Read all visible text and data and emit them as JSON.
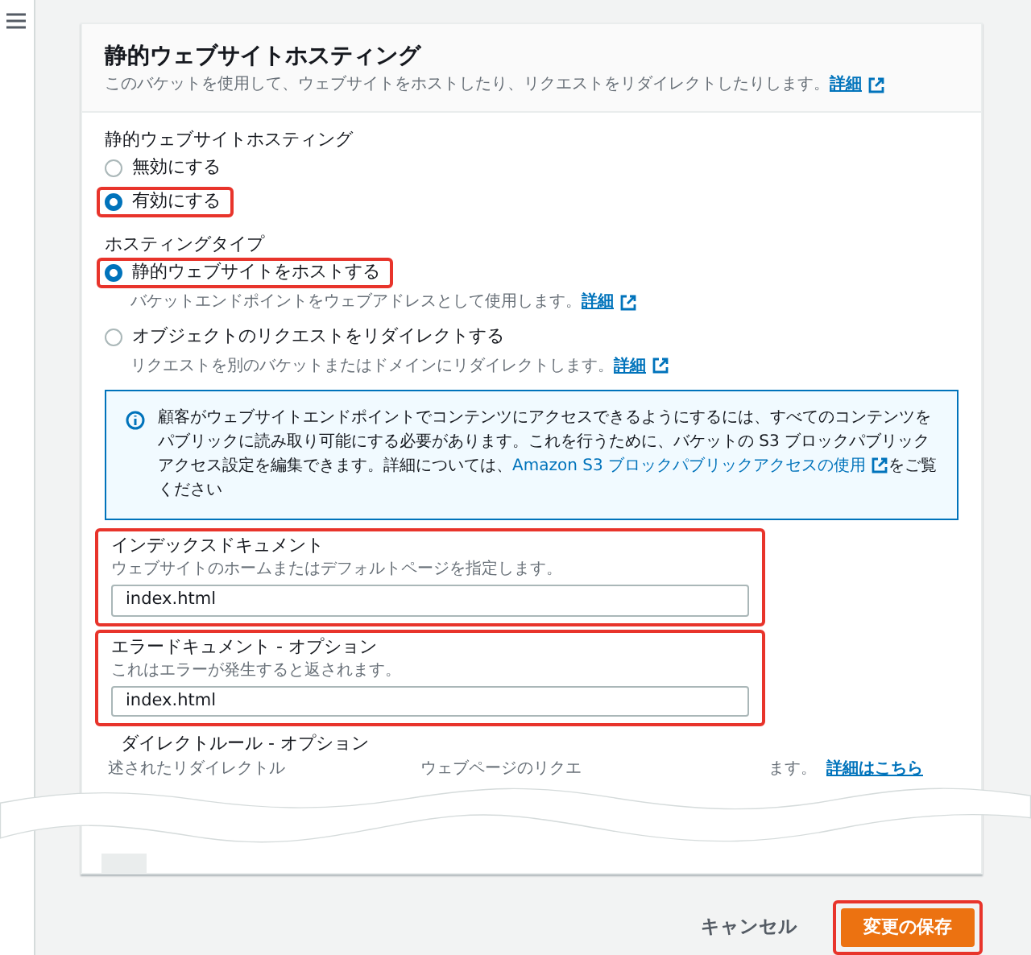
{
  "panel": {
    "title": "静的ウェブサイトホスティング",
    "description": "このバケットを使用して、ウェブサイトをホストしたり、リクエストをリダイレクトしたりします。",
    "description_link": "詳細"
  },
  "hosting": {
    "label": "静的ウェブサイトホスティング",
    "options": [
      {
        "label": "無効にする",
        "selected": false,
        "highlighted": false
      },
      {
        "label": "有効にする",
        "selected": true,
        "highlighted": true
      }
    ]
  },
  "hosting_type": {
    "label": "ホスティングタイプ",
    "options": [
      {
        "label": "静的ウェブサイトをホストする",
        "hint": "バケットエンドポイントをウェブアドレスとして使用します。",
        "hint_link": "詳細",
        "selected": true,
        "highlighted": true
      },
      {
        "label": "オブジェクトのリクエストをリダイレクトする",
        "hint": "リクエストを別のバケットまたはドメインにリダイレクトします。",
        "hint_link": "詳細",
        "selected": false,
        "highlighted": false
      }
    ]
  },
  "alert": {
    "text_before": "顧客がウェブサイトエンドポイントでコンテンツにアクセスできるようにするには、すべてのコンテンツをパブリックに読み取り可能にする必要があります。これを行うために、バケットの S3 ブロックパブリックアクセス設定を編集できます。詳細については、",
    "link": "Amazon S3 ブロックパブリックアクセスの使用",
    "text_after": "をご覧ください"
  },
  "fields": [
    {
      "label": "インデックスドキュメント",
      "hint": "ウェブサイトのホームまたはデフォルトページを指定します。",
      "value": "index.html",
      "highlighted": true
    },
    {
      "label": "エラードキュメント - オプション",
      "hint": "これはエラーが発生すると返されます。",
      "value": "index.html",
      "highlighted": true
    }
  ],
  "redirect_rules": {
    "label": "ダイレクトルール - オプション",
    "fragments": [
      "述されたリダイレクトル",
      "ウェブページのリクエ",
      "ます。"
    ],
    "link": "詳細はこちら"
  },
  "footer": {
    "buttons": [
      {
        "label": "キャンセル",
        "kind": "link",
        "highlighted": false
      },
      {
        "label": "変更の保存",
        "kind": "primary",
        "highlighted": true
      }
    ]
  }
}
